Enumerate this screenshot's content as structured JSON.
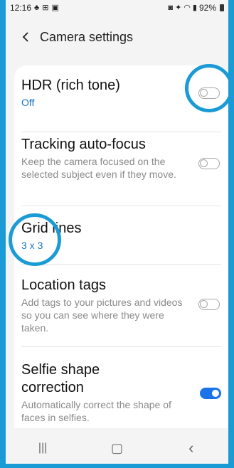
{
  "status_bar": {
    "time": "12:16",
    "left_icons": [
      "notification-icon",
      "gallery-icon",
      "image-icon"
    ],
    "right_icons": [
      "nfc-icon",
      "vibrate-icon",
      "wifi-icon",
      "signal-icon"
    ],
    "battery": "92%"
  },
  "header": {
    "back_icon": "chevron-left-icon",
    "title": "Camera settings"
  },
  "settings": {
    "hdr": {
      "title": "HDR (rich tone)",
      "value": "Off",
      "toggle_on": false
    },
    "tracking": {
      "title": "Tracking auto-focus",
      "description": "Keep the camera focused on the selected subject even if they move.",
      "toggle_on": false
    },
    "grid": {
      "title": "Grid lines",
      "value": "3 x 3"
    },
    "location": {
      "title": "Location tags",
      "description": "Add tags to your pictures and videos so you can see where they were taken.",
      "toggle_on": false
    },
    "selfie": {
      "title": "Selfie shape correction",
      "description": "Automatically correct the shape of faces in selfies.",
      "toggle_on": true
    }
  },
  "nav_bar": {
    "recents_icon": "recents-icon",
    "home_icon": "home-icon",
    "back_icon": "back-icon",
    "recents_glyph": "|||",
    "home_glyph": "▢",
    "back_glyph": "‹"
  },
  "colors": {
    "accent": "#1a73e8",
    "annotation": "#1b9bd6",
    "link_value": "#1a73c9"
  }
}
